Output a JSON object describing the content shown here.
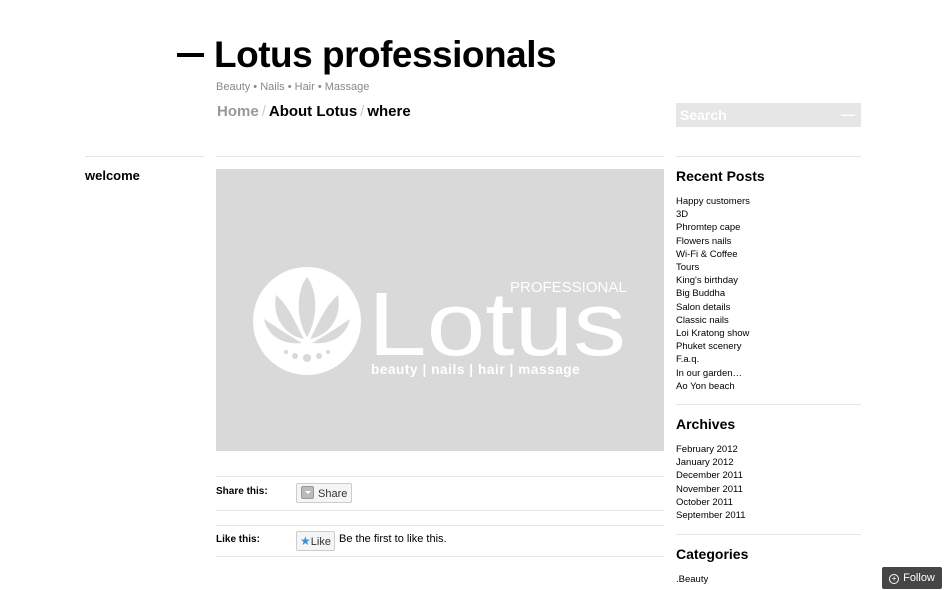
{
  "header": {
    "title": "Lotus professionals",
    "tagline": "Beauty • Nails • Hair • Massage"
  },
  "nav": {
    "items": [
      {
        "label": "Home"
      },
      {
        "label": "About Lotus"
      },
      {
        "label": "where"
      }
    ],
    "separator": "/"
  },
  "search": {
    "placeholder": "Search",
    "submit": "—"
  },
  "post": {
    "title": "welcome",
    "image": {
      "small_text": "PROFESSIONAL",
      "big_text": "Lotus",
      "tagline": "beauty | nails | hair | massage"
    },
    "share_label": "Share this:",
    "share_button": "Share",
    "like_label": "Like this:",
    "like_button": "Like",
    "like_text": "Be the first to like this."
  },
  "sidebar": {
    "recent_posts_title": "Recent Posts",
    "recent_posts": [
      "Happy customers",
      "3D",
      "Phromtep cape",
      "Flowers nails",
      "Wi-Fi & Coffee",
      "Tours",
      "King's birthday",
      "Big Buddha",
      "Salon details",
      "Classic nails",
      "Loi Kratong show",
      "Phuket scenery",
      "F.a.q.",
      "In our garden…",
      "Ao Yon beach"
    ],
    "archives_title": "Archives",
    "archives": [
      "February 2012",
      "January 2012",
      "December 2011",
      "November 2011",
      "October 2011",
      "September 2011"
    ],
    "categories_title": "Categories",
    "categories": [
      ".Beauty"
    ]
  },
  "follow": {
    "label": "Follow"
  }
}
